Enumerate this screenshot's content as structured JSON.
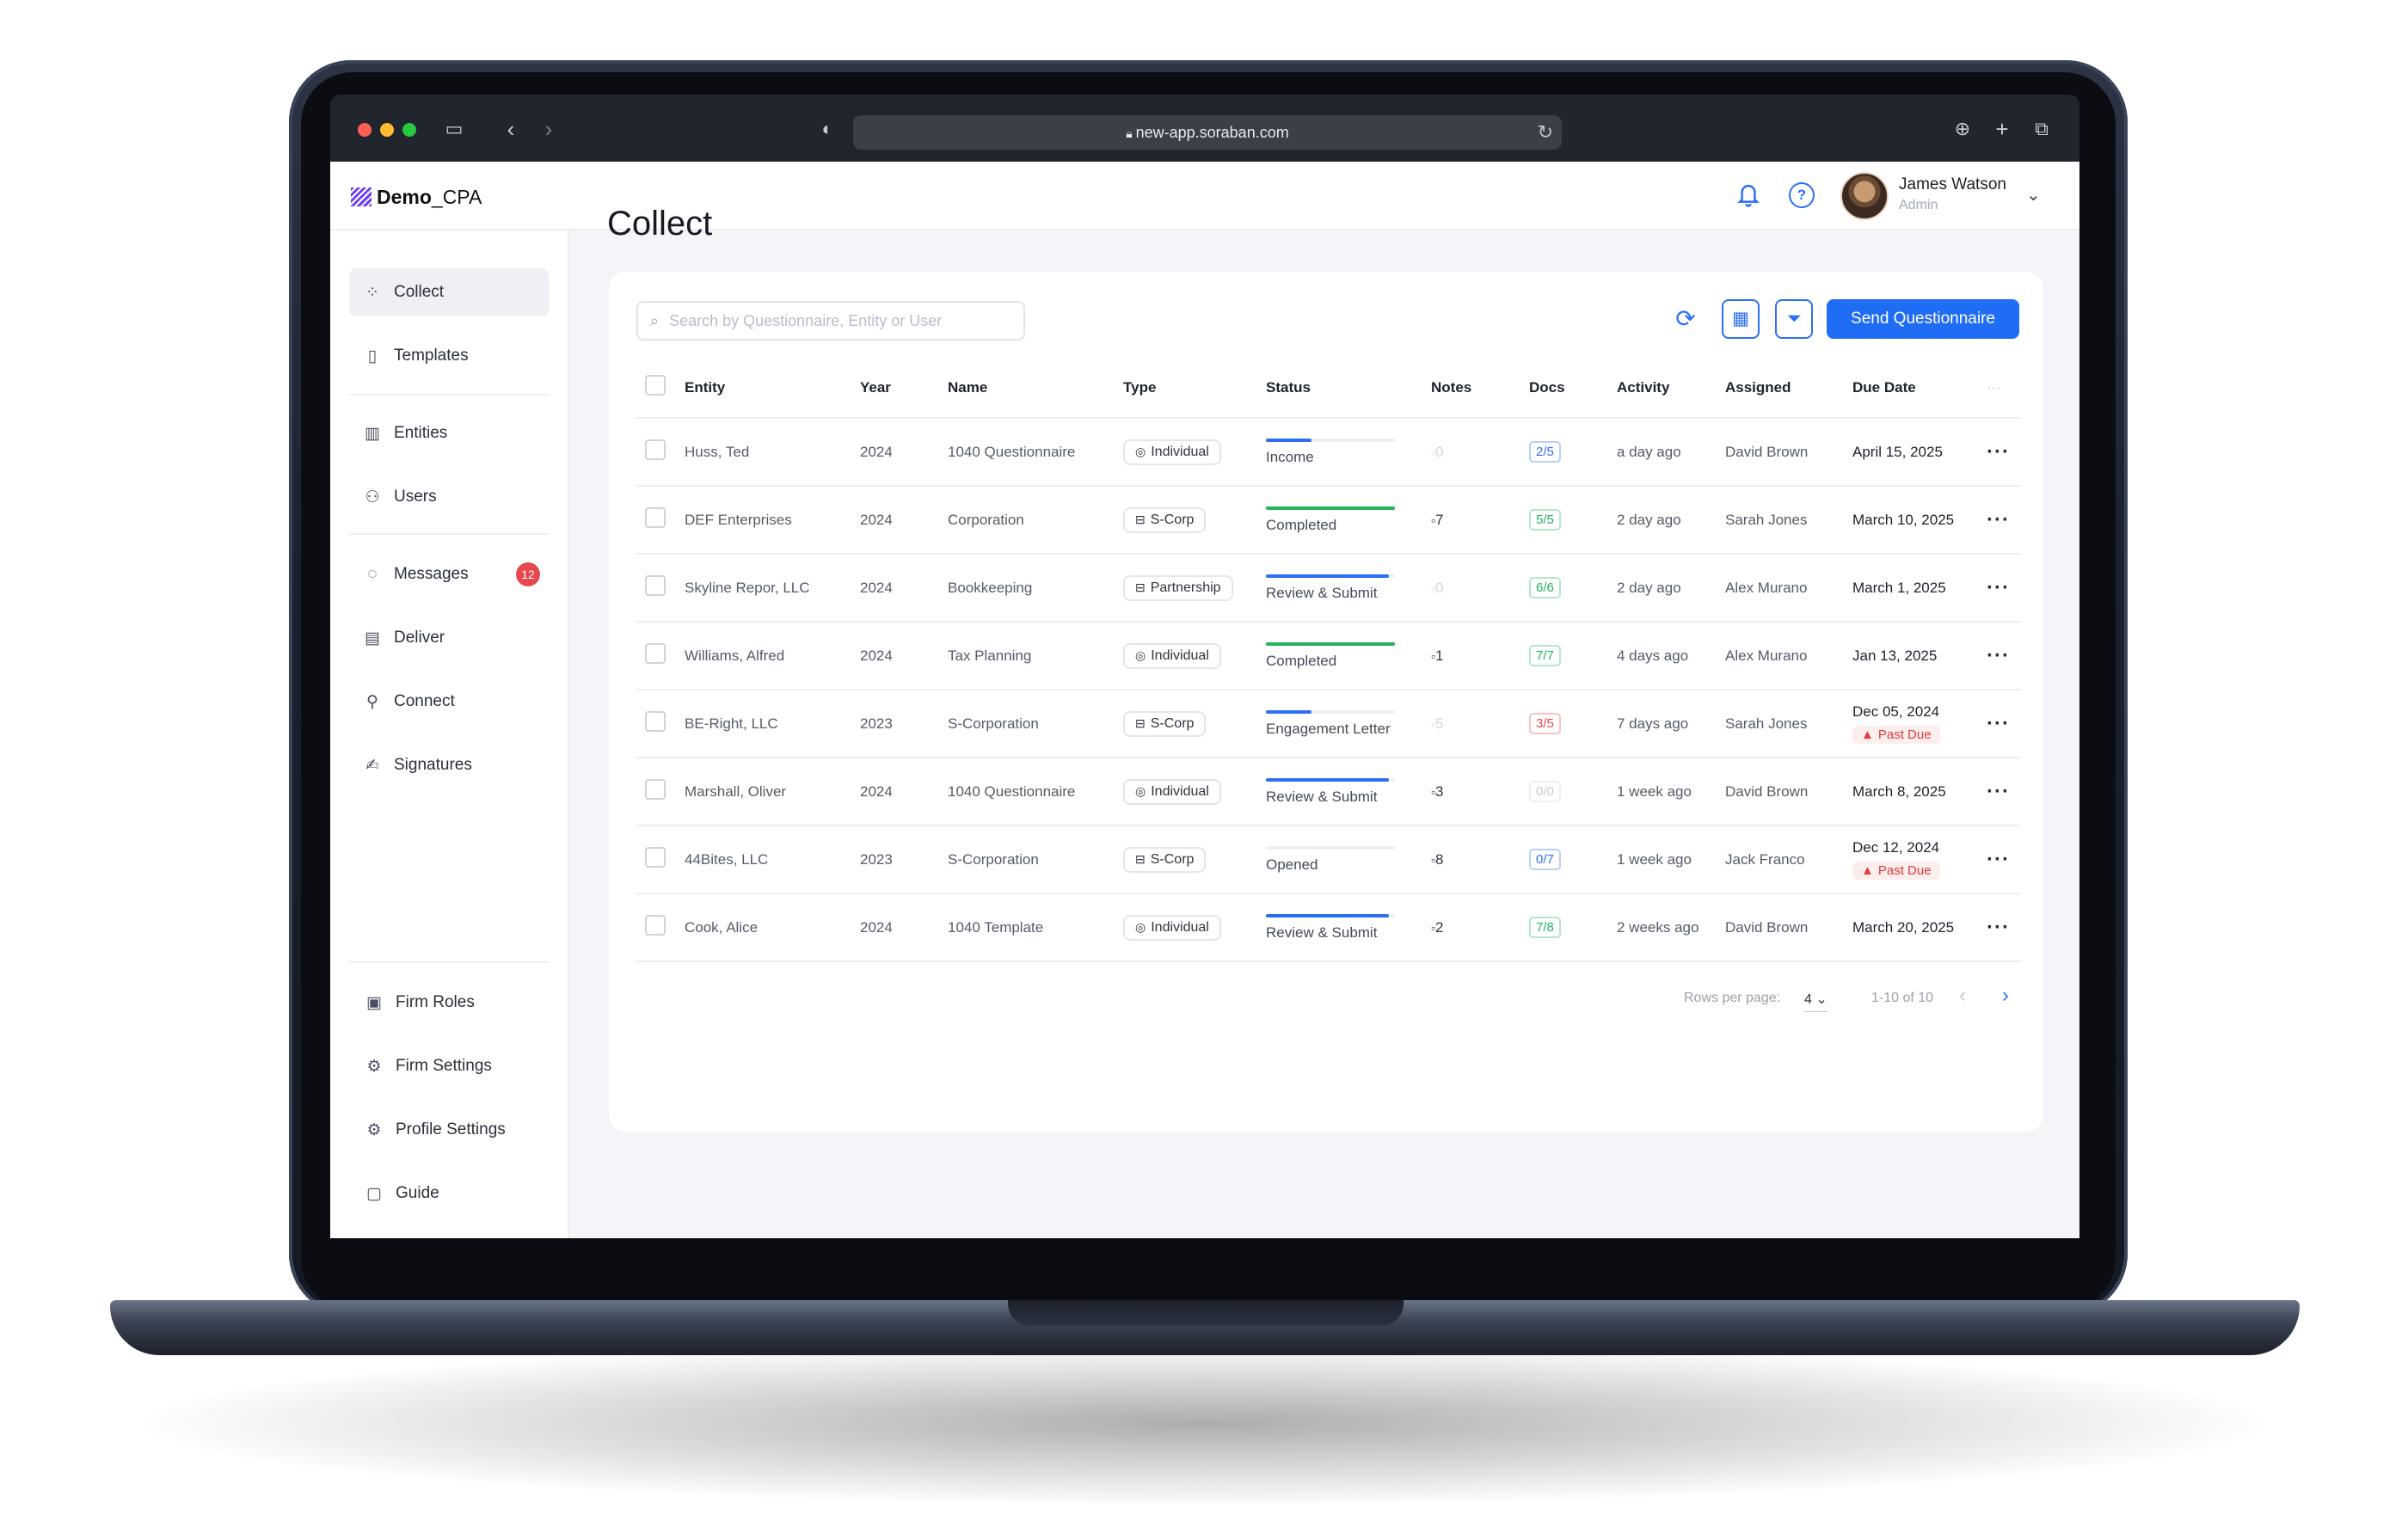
{
  "browser": {
    "url": "new-app.soraban.com"
  },
  "brand": {
    "name_bold": "Demo",
    "name_rest": "_CPA"
  },
  "user": {
    "name": "James Watson",
    "role": "Admin"
  },
  "sidebar": {
    "top_items": [
      {
        "label": "Collect",
        "icon": "collect-icon"
      },
      {
        "label": "Templates",
        "icon": "document-icon"
      }
    ],
    "mid_items": [
      {
        "label": "Entities",
        "icon": "building-icon"
      },
      {
        "label": "Users",
        "icon": "users-icon"
      }
    ],
    "main_items": [
      {
        "label": "Messages",
        "icon": "chat-icon",
        "badge": "12"
      },
      {
        "label": "Deliver",
        "icon": "deliver-icon"
      },
      {
        "label": "Connect",
        "icon": "plug-icon"
      },
      {
        "label": "Signatures",
        "icon": "signature-icon"
      }
    ],
    "bottom_items": [
      {
        "label": "Firm Roles",
        "icon": "id-card-icon"
      },
      {
        "label": "Firm Settings",
        "icon": "gear-icon"
      },
      {
        "label": "Profile Settings",
        "icon": "profile-gear-icon"
      },
      {
        "label": "Guide",
        "icon": "book-icon"
      }
    ]
  },
  "page": {
    "title": "Collect"
  },
  "toolbar": {
    "search_placeholder": "Search by Questionnaire, Entity or User",
    "send_label": "Send Questionnaire"
  },
  "table": {
    "headers": {
      "entity": "Entity",
      "year": "Year",
      "name": "Name",
      "type": "Type",
      "status": "Status",
      "notes": "Notes",
      "docs": "Docs",
      "activity": "Activity",
      "assigned": "Assigned",
      "due": "Due Date",
      "more": "···"
    },
    "rows": [
      {
        "entity": "Huss, Ted",
        "year": "2024",
        "name": "1040 Questionnaire",
        "type": "Individual",
        "type_icon": "person-icon",
        "status": "Income",
        "status_progress": 0.35,
        "status_color": "#2b6ff6",
        "notes": "0",
        "notes_dim": true,
        "docs": "2/5",
        "docs_color": "#2b6ff6",
        "activity": "a day ago",
        "assigned": "David Brown",
        "due": "April 15, 2025",
        "past_due": ""
      },
      {
        "entity": "DEF Enterprises",
        "year": "2024",
        "name": "Corporation",
        "type": "S-Corp",
        "type_icon": "briefcase-icon",
        "status": "Completed",
        "status_progress": 1.0,
        "status_color": "#22b35e",
        "notes": "7",
        "notes_dim": false,
        "docs": "5/5",
        "docs_color": "#22b35e",
        "activity": "2 day ago",
        "assigned": "Sarah Jones",
        "due": "March 10, 2025",
        "past_due": ""
      },
      {
        "entity": "Skyline Repor, LLC",
        "year": "2024",
        "name": "Bookkeeping",
        "type": "Partnership",
        "type_icon": "briefcase-icon",
        "status": "Review & Submit",
        "status_progress": 0.95,
        "status_color": "#2b6ff6",
        "notes": "0",
        "notes_dim": true,
        "docs": "6/6",
        "docs_color": "#22b35e",
        "activity": "2 day ago",
        "assigned": "Alex Murano",
        "due": "March 1, 2025",
        "past_due": ""
      },
      {
        "entity": "Williams, Alfred",
        "year": "2024",
        "name": "Tax Planning",
        "type": "Individual",
        "type_icon": "person-icon",
        "status": "Completed",
        "status_progress": 1.0,
        "status_color": "#22b35e",
        "notes": "1",
        "notes_dim": false,
        "docs": "7/7",
        "docs_color": "#22b35e",
        "activity": "4 days ago",
        "assigned": "Alex Murano",
        "due": "Jan 13, 2025",
        "past_due": ""
      },
      {
        "entity": "BE-Right, LLC",
        "year": "2023",
        "name": "S-Corporation",
        "type": "S-Corp",
        "type_icon": "briefcase-icon",
        "status": "Engagement Letter",
        "status_progress": 0.35,
        "status_color": "#2b6ff6",
        "notes": "5",
        "notes_dim": true,
        "docs": "3/5",
        "docs_color": "#e5484d",
        "activity": "7 days ago",
        "assigned": "Sarah Jones",
        "due": "Dec 05, 2024",
        "past_due": "Past Due"
      },
      {
        "entity": "Marshall, Oliver",
        "year": "2024",
        "name": "1040 Questionnaire",
        "type": "Individual",
        "type_icon": "person-icon",
        "status": "Review & Submit",
        "status_progress": 0.95,
        "status_color": "#2b6ff6",
        "notes": "3",
        "notes_dim": false,
        "docs": "0/0",
        "docs_color": "#c9ccd3",
        "activity": "1 week ago",
        "assigned": "David Brown",
        "due": "March 8, 2025",
        "past_due": ""
      },
      {
        "entity": "44Bites, LLC",
        "year": "2023",
        "name": "S-Corporation",
        "type": "S-Corp",
        "type_icon": "briefcase-icon",
        "status": "Opened",
        "status_progress": 0.0,
        "status_color": "#2b6ff6",
        "notes": "8",
        "notes_dim": false,
        "docs": "0/7",
        "docs_color": "#2b6ff6",
        "activity": "1 week ago",
        "assigned": "Jack Franco",
        "due": "Dec 12, 2024",
        "past_due": "Past Due"
      },
      {
        "entity": "Cook, Alice",
        "year": "2024",
        "name": "1040 Template",
        "type": "Individual",
        "type_icon": "person-icon",
        "status": "Review & Submit",
        "status_progress": 0.95,
        "status_color": "#2b6ff6",
        "notes": "2",
        "notes_dim": false,
        "docs": "7/8",
        "docs_color": "#22b35e",
        "activity": "2 weeks ago",
        "assigned": "David Brown",
        "due": "March 20, 2025",
        "past_due": ""
      }
    ]
  },
  "pagination": {
    "rows_per_page_label": "Rows per page:",
    "rows_per_page_value": "4",
    "range": "1-10 of 10"
  }
}
